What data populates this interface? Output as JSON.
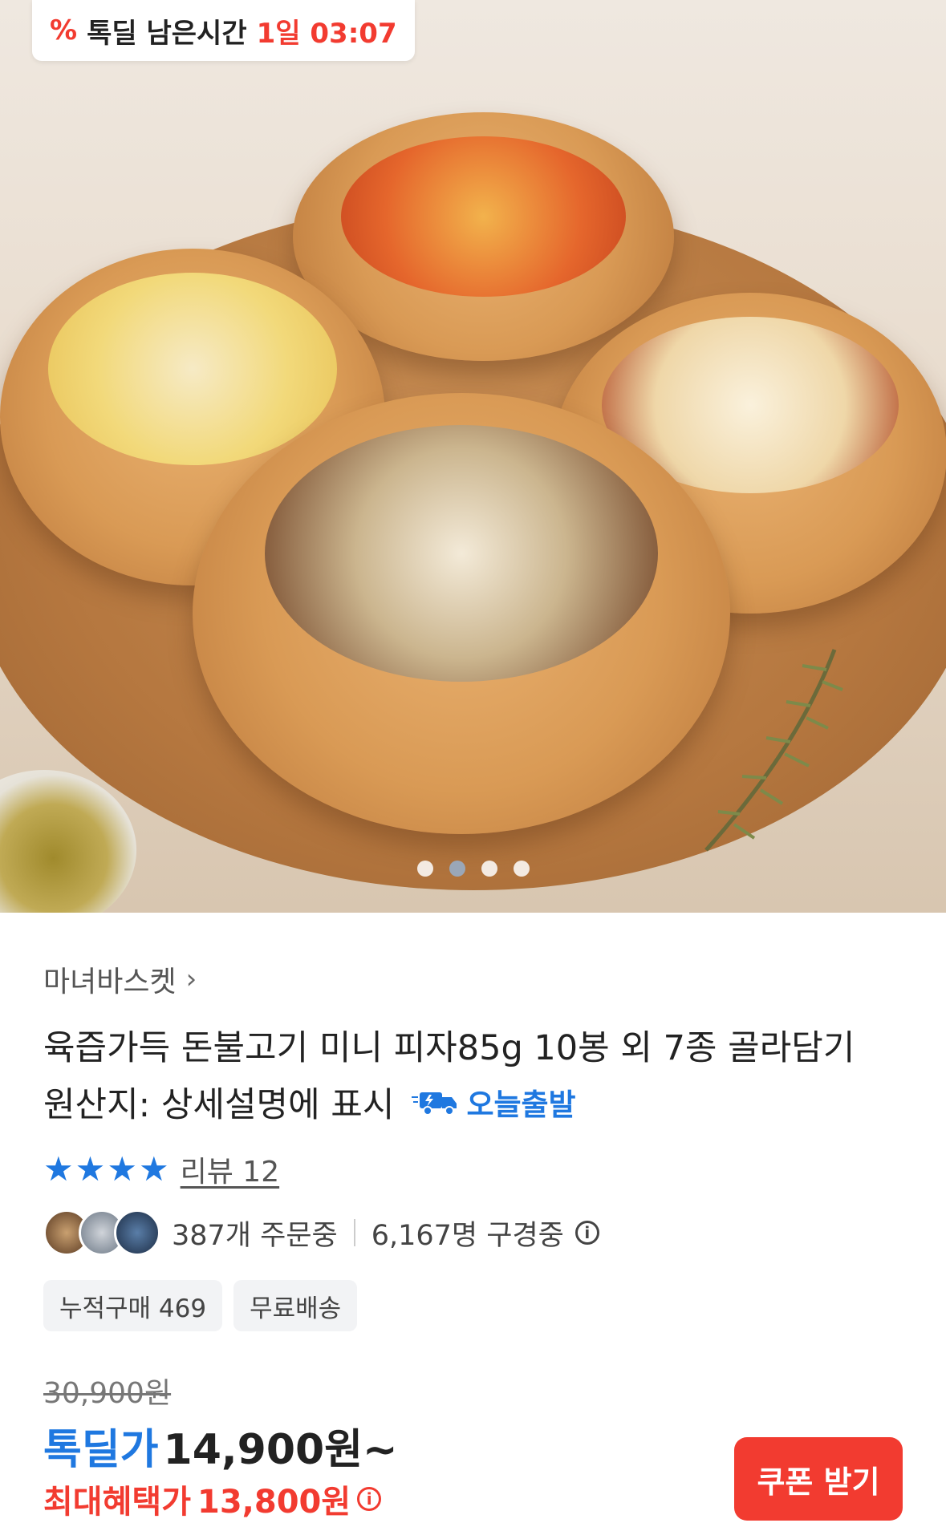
{
  "timer": {
    "icon": "percent-icon",
    "label": "톡딜 남은시간",
    "time": "1일 03:07"
  },
  "carousel": {
    "count": 4,
    "active_index": 1
  },
  "product": {
    "seller": "마녀바스켓",
    "title_line1": "육즙가득 돈불고기 미니 피자85g 10봉 외 7종 골라담기",
    "origin": "원산지: 상세설명에 표시",
    "today_ship": "오늘출발"
  },
  "rating": {
    "stars": 4,
    "review_label": "리뷰 12"
  },
  "social": {
    "orders": "387개 주문중",
    "viewers": "6,167명 구경중"
  },
  "tags": [
    "누적구매 469",
    "무료배송"
  ],
  "price": {
    "original": "30,900원",
    "deal_label": "톡딜가",
    "deal_price": "14,900원~",
    "max_label": "최대혜택가",
    "max_price": "13,800원"
  },
  "coupon_button": "쿠폰 받기",
  "colors": {
    "accent_blue": "#1f78e0",
    "accent_red": "#f23b30"
  }
}
